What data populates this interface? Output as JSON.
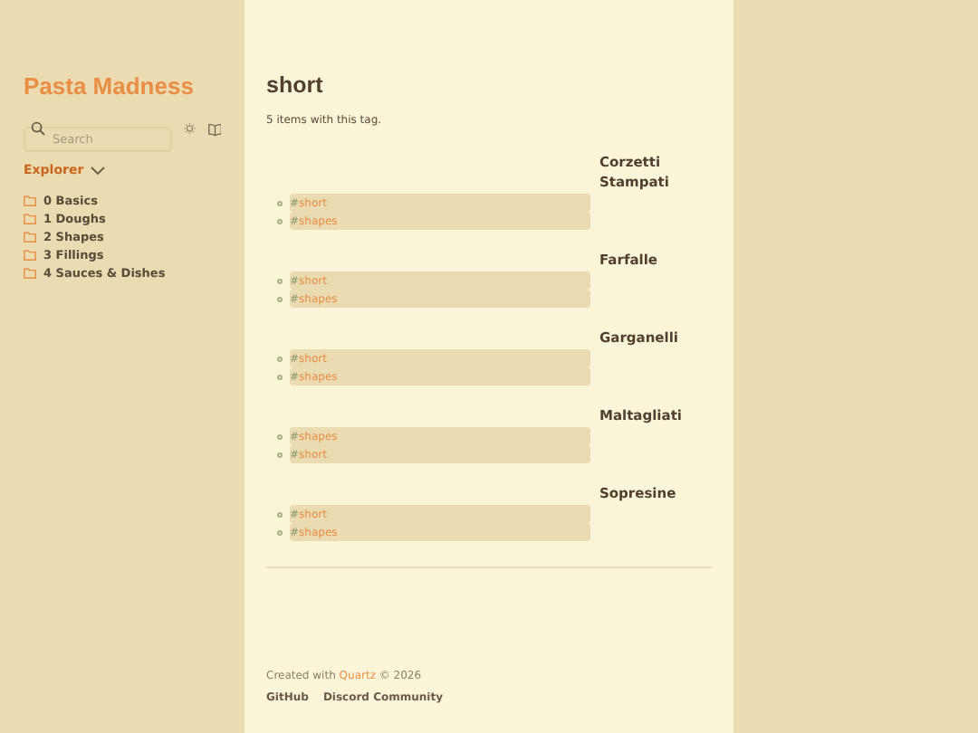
{
  "sidebar": {
    "site_title": "Pasta Madness",
    "search": {
      "placeholder": "Search"
    },
    "explorer": {
      "title": "Explorer",
      "expanded": true,
      "folders": [
        "0 Basics",
        "1 Doughs",
        "2 Shapes",
        "3 Fillings",
        "4 Sauces & Dishes"
      ]
    }
  },
  "page": {
    "title": "short",
    "count": "5 items with this tag.",
    "items": [
      {
        "title": "Corzetti Stampati",
        "tags": [
          {
            "hash": "#",
            "label": "short"
          },
          {
            "hash": "#",
            "label": "shapes"
          }
        ]
      },
      {
        "title": "Farfalle",
        "tags": [
          {
            "hash": "#",
            "label": "short"
          },
          {
            "hash": "#",
            "label": "shapes"
          }
        ]
      },
      {
        "title": "Garganelli",
        "tags": [
          {
            "hash": "#",
            "label": "short"
          },
          {
            "hash": "#",
            "label": "shapes"
          }
        ]
      },
      {
        "title": "Maltagliati",
        "tags": [
          {
            "hash": "#",
            "label": "shapes"
          },
          {
            "hash": "#",
            "label": "short"
          }
        ]
      },
      {
        "title": "Sopresine",
        "tags": [
          {
            "hash": "#",
            "label": "short"
          },
          {
            "hash": "#",
            "label": "shapes"
          }
        ]
      }
    ]
  },
  "footer": {
    "prefix": "Created with ",
    "link": "Quartz",
    "suffix": " © 2026",
    "links": [
      "GitHub",
      "Discord Community"
    ]
  }
}
